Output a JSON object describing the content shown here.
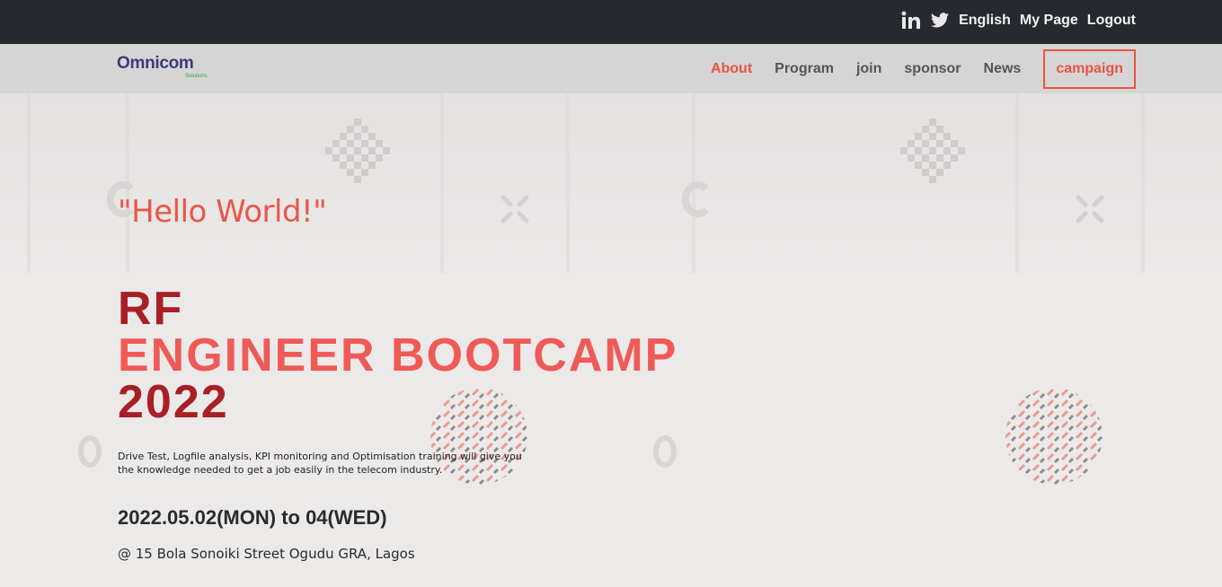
{
  "topbar": {
    "linkedin_icon": "linkedin-icon",
    "twitter_icon": "twitter-icon",
    "language": "English",
    "my_page": "My Page",
    "logout": "Logout"
  },
  "brand": {
    "logo_text": "Omnicom",
    "logo_sub": "Solutions"
  },
  "nav": {
    "items": [
      {
        "label": "About"
      },
      {
        "label": "Program"
      },
      {
        "label": "join"
      },
      {
        "label": "sponsor"
      },
      {
        "label": "News"
      },
      {
        "label": "campaign"
      }
    ]
  },
  "hero": {
    "greeting": "\"Hello World!\"",
    "title_line1": "RF",
    "title_line2": "ENGINEER BOOTCAMP",
    "title_line3": "2022",
    "description": "Drive Test, Logfile analysis, KPI monitoring and Optimisation training will give you the knowledge needed to get a job easily in the telecom industry.",
    "date": "2022.05.02(MON) to 04(WED)",
    "address": "@ 15 Bola Sonoiki Street Ogudu GRA, Lagos"
  },
  "colors": {
    "topbar_bg": "#262930",
    "navbar_bg": "#d5d5d5",
    "accent": "#ea5443",
    "title_dark": "#a81f25",
    "title_light": "#ef5a57"
  }
}
